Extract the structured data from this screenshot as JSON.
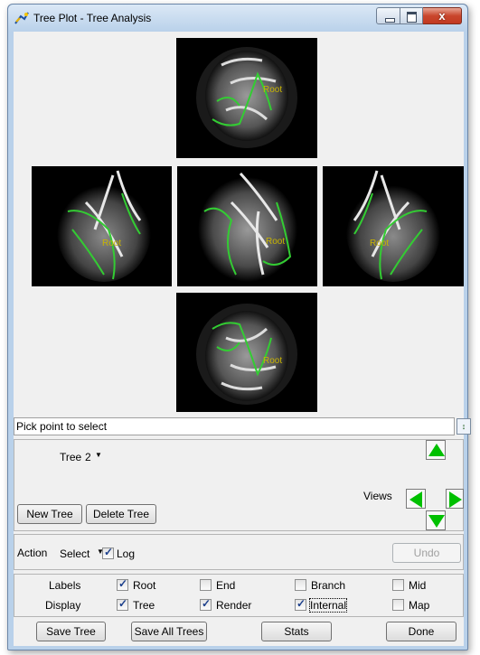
{
  "window": {
    "title": "Tree Plot - Tree Analysis",
    "close_glyph": "x"
  },
  "views": {
    "root_label": "Root"
  },
  "status": {
    "message": "Pick point to select",
    "button_glyph": "↕"
  },
  "tree_panel": {
    "tree_label": "Tree",
    "tree_value": "2",
    "new_tree": "New Tree",
    "delete_tree": "Delete Tree",
    "views_label": "Views"
  },
  "action_panel": {
    "action_label": "Action",
    "select_value": "Select",
    "log_label": "Log",
    "log_checked": true,
    "undo_label": "Undo"
  },
  "labels_panel": {
    "labels_row": "Labels",
    "display_row": "Display",
    "labels": [
      {
        "text": "Root",
        "checked": true
      },
      {
        "text": "End",
        "checked": false
      },
      {
        "text": "Branch",
        "checked": false
      },
      {
        "text": "Mid",
        "checked": false
      }
    ],
    "display": [
      {
        "text": "Tree",
        "checked": true
      },
      {
        "text": "Render",
        "checked": true
      },
      {
        "text": "Internal",
        "checked": true
      },
      {
        "text": "Map",
        "checked": false
      }
    ]
  },
  "footer": {
    "save_tree": "Save Tree",
    "save_all": "Save All Trees",
    "stats": "Stats",
    "done": "Done"
  },
  "colors": {
    "vessel_green": "#33cc33",
    "root_label": "#c8b400",
    "arrow_green": "#00c000"
  }
}
